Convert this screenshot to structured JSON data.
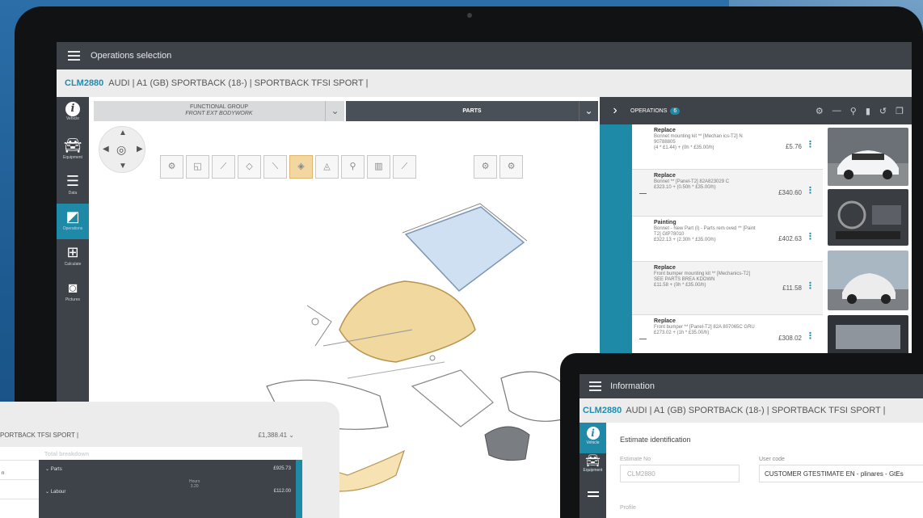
{
  "main": {
    "topbar_title": "Operations selection",
    "vehicle_code": "CLM2880",
    "vehicle_desc": "AUDI | A1 (GB) SPORTBACK (18-) | SPORTBACK TFSI SPORT |",
    "nav": [
      {
        "label": "Vehicle"
      },
      {
        "label": "Equipment"
      },
      {
        "label": "Data"
      },
      {
        "label": "Operations"
      },
      {
        "label": "Calculate"
      },
      {
        "label": "Pictures"
      }
    ],
    "functional_group_label": "FUNCTIONAL GROUP",
    "functional_group_value": "FRONT EXT BODYWORK",
    "parts_label": "PARTS",
    "operations_title": "OPERATIONS",
    "operations_count": "6",
    "operations": [
      {
        "type": "Replace",
        "desc": "Bonnet mounting kit ** [Mechan ics-T2] N 90788805",
        "calc": "(4 * £1.44) + (0h * £35.00/h)",
        "price": "£5.76"
      },
      {
        "type": "Replace",
        "desc": "Bonnet ** [Panel-T2] 82A823029 C",
        "calc": "£323.10 + (0.50h * £35.00/h)",
        "price": "£340.60"
      },
      {
        "type": "Painting",
        "desc": "Bonnet - New Part (I) - Parts rem oved ** [Paint T2] GtP78010",
        "calc": "£322.13 + (2.30h * £35.00/h)",
        "price": "£402.63"
      },
      {
        "type": "Replace",
        "desc": "Front bumper mounting kit ** [Mechanics-T2] SEE PARTS BREA KDOWN",
        "calc": "£11.58 + (0h * £35.00/h)",
        "price": "£11.58"
      },
      {
        "type": "Replace",
        "desc": "Front bumper ** [Panel-T2] 82A 807065C GRU",
        "calc": "£273.02 + (1h * £35.00/h)",
        "price": "£308.02"
      }
    ]
  },
  "info": {
    "topbar_title": "Information",
    "vehicle_code": "CLM2880",
    "vehicle_desc": "AUDI | A1 (GB) SPORTBACK (18-) | SPORTBACK TFSI SPORT |",
    "nav_vehicle": "Vehicle",
    "nav_equipment": "Equipment",
    "section_title": "Estimate identification",
    "estimate_no_label": "Estimate No",
    "estimate_no_value": "CLM2880",
    "user_code_label": "User code",
    "user_code_value": "CUSTOMER GTESTIMATE EN - plinares - GtEs",
    "profile_label": "Profile"
  },
  "tablet": {
    "vehicle_desc": "PORTBACK TFSI SPORT |",
    "total": "£1,388.41",
    "breakdown_title": "Total breakdown",
    "left_label": "n",
    "rows": [
      {
        "label": "Parts",
        "value": "£925.73"
      },
      {
        "label": "Labour",
        "value": "£112.00"
      }
    ],
    "hours_label": "Hours",
    "hours_value": "3.20"
  },
  "colors": {
    "accent": "#1f8aa8",
    "dark": "#3d4349",
    "code": "#1e8db0",
    "highlight": "#f3d7a0"
  }
}
